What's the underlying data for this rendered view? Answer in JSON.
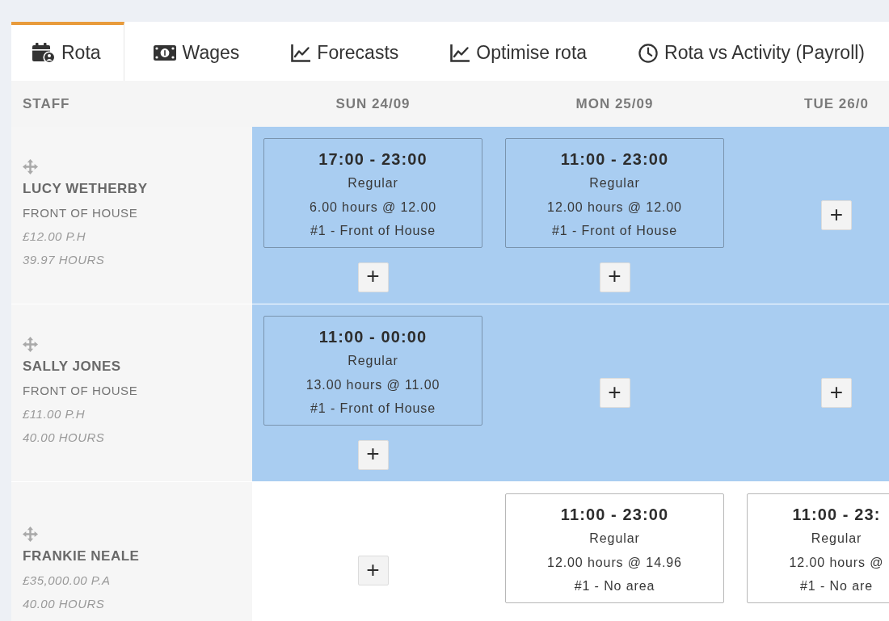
{
  "tabs": [
    {
      "label": "Rota",
      "selected": true
    },
    {
      "label": "Wages",
      "selected": false
    },
    {
      "label": "Forecasts",
      "selected": false
    },
    {
      "label": "Optimise rota",
      "selected": false
    },
    {
      "label": "Rota vs Activity (Payroll)",
      "selected": false
    }
  ],
  "rota": {
    "columns": [
      "STAFF",
      "SUN 24/09",
      "MON 25/09",
      "TUE 26/0"
    ],
    "rows": [
      {
        "highlighted": true,
        "staff": {
          "name": "LUCY WETHERBY",
          "department": "FRONT OF HOUSE",
          "rate": "£12.00 P.H",
          "hours": "39.97 HOURS"
        },
        "days": [
          {
            "shifts": [
              {
                "time": "17:00 - 23:00",
                "type": "Regular",
                "hours": "6.00 hours @ 12.00",
                "area": "#1 - Front of House"
              }
            ],
            "add_button": "+"
          },
          {
            "shifts": [
              {
                "time": "11:00 - 23:00",
                "type": "Regular",
                "hours": "12.00 hours @ 12.00",
                "area": "#1 - Front of House"
              }
            ],
            "add_button": "+"
          },
          {
            "add_button": "+"
          }
        ]
      },
      {
        "highlighted": true,
        "staff": {
          "name": "SALLY JONES",
          "department": "FRONT OF HOUSE",
          "rate": "£11.00 P.H",
          "hours": "40.00 HOURS"
        },
        "days": [
          {
            "shifts": [
              {
                "time": "11:00 - 00:00",
                "type": "Regular",
                "hours": "13.00 hours @ 11.00",
                "area": "#1 - Front of House"
              }
            ],
            "add_button": "+"
          },
          {
            "add_button": "+"
          },
          {
            "add_button": "+"
          }
        ]
      },
      {
        "highlighted": false,
        "staff": {
          "name": "FRANKIE NEALE",
          "rate": "£35,000.00 P.A",
          "hours": "40.00 HOURS"
        },
        "days": [
          {
            "add_button": "+"
          },
          {
            "shifts": [
              {
                "time": "11:00 - 23:00",
                "type": "Regular",
                "hours": "12.00 hours @ 14.96",
                "area": "#1 - No area"
              }
            ]
          },
          {
            "shifts": [
              {
                "time": "11:00 - 23:",
                "type": "Regular",
                "hours": "12.00 hours @",
                "area": "#1 - No are"
              }
            ]
          }
        ]
      }
    ]
  }
}
